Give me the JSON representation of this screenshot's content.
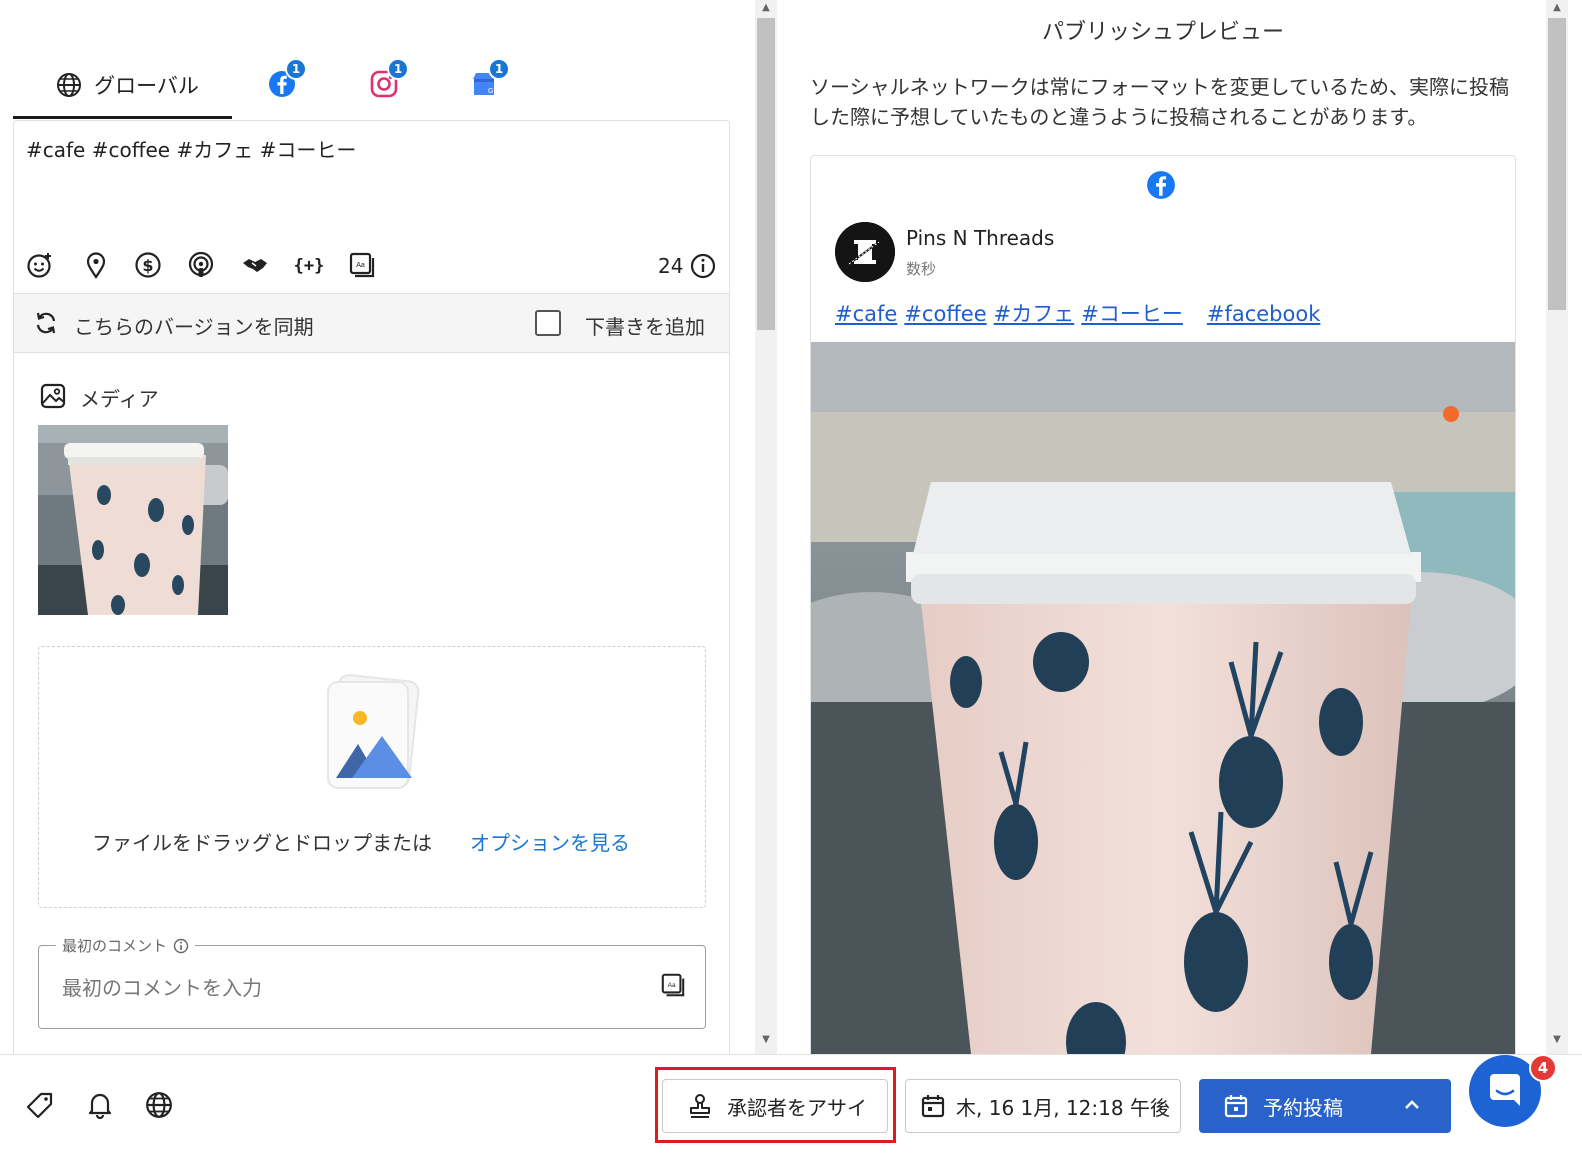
{
  "tabs": {
    "global_label": "グローバル",
    "facebook_badge": "1",
    "instagram_badge": "1",
    "gmb_badge": "1"
  },
  "editor": {
    "post_text": "#cafe #coffee #カフェ #コーヒー",
    "char_count": "24",
    "sync_label": "こちらのバージョンを同期",
    "draft_label": "下書きを追加",
    "media_label": "メディア",
    "drop_text": "ファイルをドラッグとドロップまたは",
    "drop_link": "オプションを見る",
    "first_comment_legend": "最初のコメント",
    "first_comment_placeholder": "最初のコメントを入力"
  },
  "preview": {
    "title": "パブリッシュプレビュー",
    "description": "ソーシャルネットワークは常にフォーマットを変更しているため、実際に投稿した際に予想していたものと違うように投稿されることがあります。",
    "account_name": "Pins N Threads",
    "post_time": "数秒",
    "hashtags": [
      "#cafe",
      "#coffee",
      "#カフェ",
      "#コーヒー",
      "#facebook"
    ]
  },
  "bottom": {
    "approver_label": "承認者をアサイン",
    "date_label": "木, 16 1月, 12:18 午後",
    "schedule_label": "予約投稿",
    "chat_badge": "4"
  },
  "colors": {
    "accent": "#2962c9",
    "link": "#1976d2",
    "highlight": "#e01b1b",
    "facebook": "#1877f2",
    "instagram": "#e1306c"
  }
}
